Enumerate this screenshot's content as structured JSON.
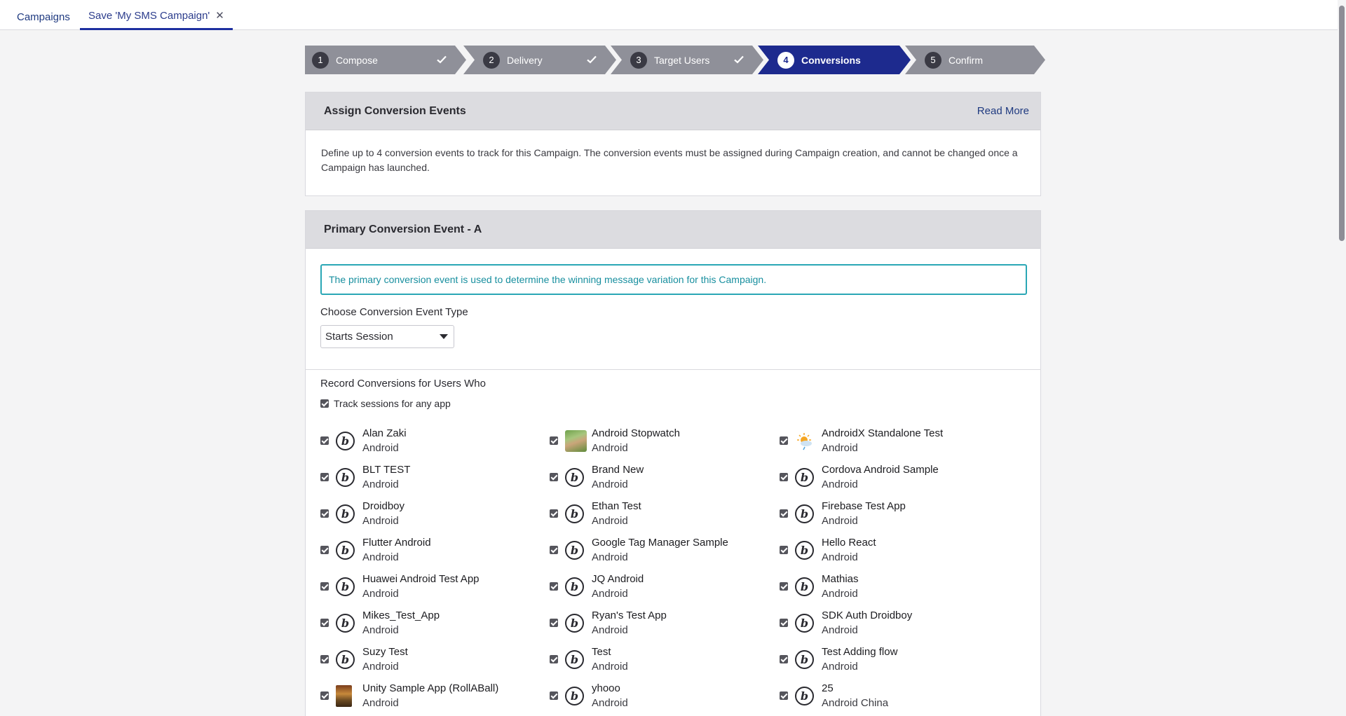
{
  "tabs": {
    "campaigns": "Campaigns",
    "save": "Save 'My SMS Campaign'",
    "close_icon": "close-icon"
  },
  "steps": [
    {
      "num": "1",
      "label": "Compose",
      "done": true
    },
    {
      "num": "2",
      "label": "Delivery",
      "done": true
    },
    {
      "num": "3",
      "label": "Target Users",
      "done": true
    },
    {
      "num": "4",
      "label": "Conversions",
      "active": true
    },
    {
      "num": "5",
      "label": "Confirm"
    }
  ],
  "assign": {
    "title": "Assign Conversion Events",
    "read_more": "Read More",
    "description": "Define up to 4 conversion events to track for this Campaign. The conversion events must be assigned during Campaign creation, and cannot be changed once a Campaign has launched."
  },
  "primary": {
    "title": "Primary Conversion Event - A",
    "info": "The primary conversion event is used to determine the winning message variation for this Campaign.",
    "event_type_label": "Choose Conversion Event Type",
    "event_type_value": "Starts Session",
    "record_label": "Record Conversions for Users Who",
    "any_app_label": "Track sessions for any app"
  },
  "apps": [
    {
      "name": "Alan Zaki",
      "platform": "Android"
    },
    {
      "name": "Android Stopwatch",
      "platform": "Android"
    },
    {
      "name": "AndroidX Standalone Test",
      "platform": "Android"
    },
    {
      "name": "BLT TEST",
      "platform": "Android"
    },
    {
      "name": "Brand New",
      "platform": "Android"
    },
    {
      "name": "Cordova Android Sample",
      "platform": "Android"
    },
    {
      "name": "Droidboy",
      "platform": "Android"
    },
    {
      "name": "Ethan Test",
      "platform": "Android"
    },
    {
      "name": "Firebase Test App",
      "platform": "Android"
    },
    {
      "name": "Flutter Android",
      "platform": "Android"
    },
    {
      "name": "Google Tag Manager Sample",
      "platform": "Android"
    },
    {
      "name": "Hello React",
      "platform": "Android"
    },
    {
      "name": "Huawei Android Test App",
      "platform": "Android"
    },
    {
      "name": "JQ Android",
      "platform": "Android"
    },
    {
      "name": "Mathias",
      "platform": "Android"
    },
    {
      "name": "Mikes_Test_App",
      "platform": "Android"
    },
    {
      "name": "Ryan's Test App",
      "platform": "Android"
    },
    {
      "name": "SDK Auth Droidboy",
      "platform": "Android"
    },
    {
      "name": "Suzy Test",
      "platform": "Android"
    },
    {
      "name": "Test",
      "platform": "Android"
    },
    {
      "name": "Test Adding flow",
      "platform": "Android"
    },
    {
      "name": "Unity Sample App (RollABall)",
      "platform": "Android"
    },
    {
      "name": "yhooo",
      "platform": "Android"
    },
    {
      "name": "25",
      "platform": "Android China"
    }
  ]
}
